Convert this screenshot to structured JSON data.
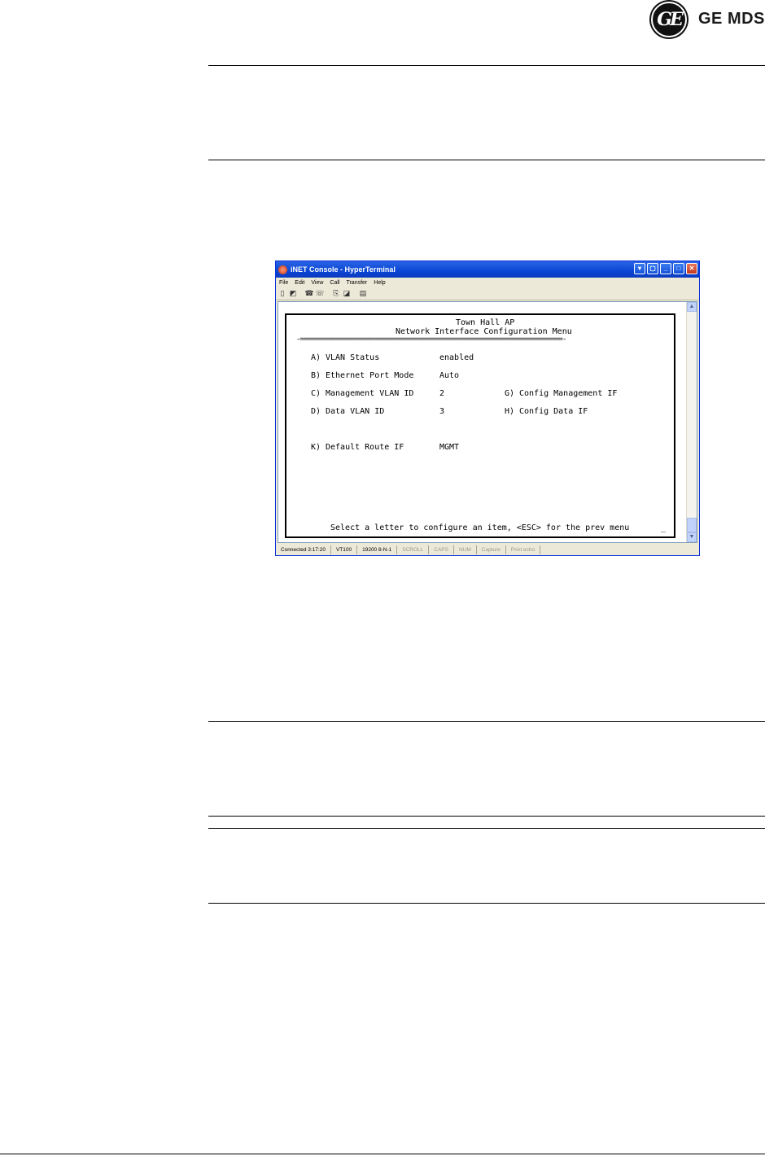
{
  "logo": {
    "brand_text": "GE MDS",
    "seal_text": "GE"
  },
  "window": {
    "title": "iNET Console - HyperTerminal",
    "menus": [
      "File",
      "Edit",
      "View",
      "Call",
      "Transfer",
      "Help"
    ],
    "toolbar_icons": [
      "new-icon",
      "open-icon",
      "connect-icon",
      "disconnect-icon",
      "send-icon",
      "receive-icon",
      "properties-icon"
    ]
  },
  "terminal": {
    "device_name": "Town Hall AP",
    "menu_title": "Network Interface Configuration Menu",
    "separator": "-=========================================================================-",
    "items": [
      {
        "key": "A)",
        "label": "VLAN Status",
        "value": "enabled"
      },
      {
        "key": "B)",
        "label": "Ethernet Port Mode",
        "value": "Auto"
      },
      {
        "key": "C)",
        "label": "Management VLAN ID",
        "value": "2"
      },
      {
        "key": "D)",
        "label": "Data VLAN ID",
        "value": "3"
      },
      {
        "key": "K)",
        "label": "Default Route IF",
        "value": "MGMT"
      }
    ],
    "right_items": [
      {
        "key": "G)",
        "label": "Config Management IF"
      },
      {
        "key": "H)",
        "label": "Config Data IF"
      }
    ],
    "prompt": "Select a letter to configure an item, <ESC> for the prev menu",
    "cursor": "_"
  },
  "statusbar": {
    "cells": [
      {
        "text": "Connected 3:17:20",
        "dim": false
      },
      {
        "text": "VT100",
        "dim": false
      },
      {
        "text": "19200 8-N-1",
        "dim": false
      },
      {
        "text": "SCROLL",
        "dim": true
      },
      {
        "text": "CAPS",
        "dim": true
      },
      {
        "text": "NUM",
        "dim": true
      },
      {
        "text": "Capture",
        "dim": true
      },
      {
        "text": "Print echo",
        "dim": true
      }
    ]
  }
}
